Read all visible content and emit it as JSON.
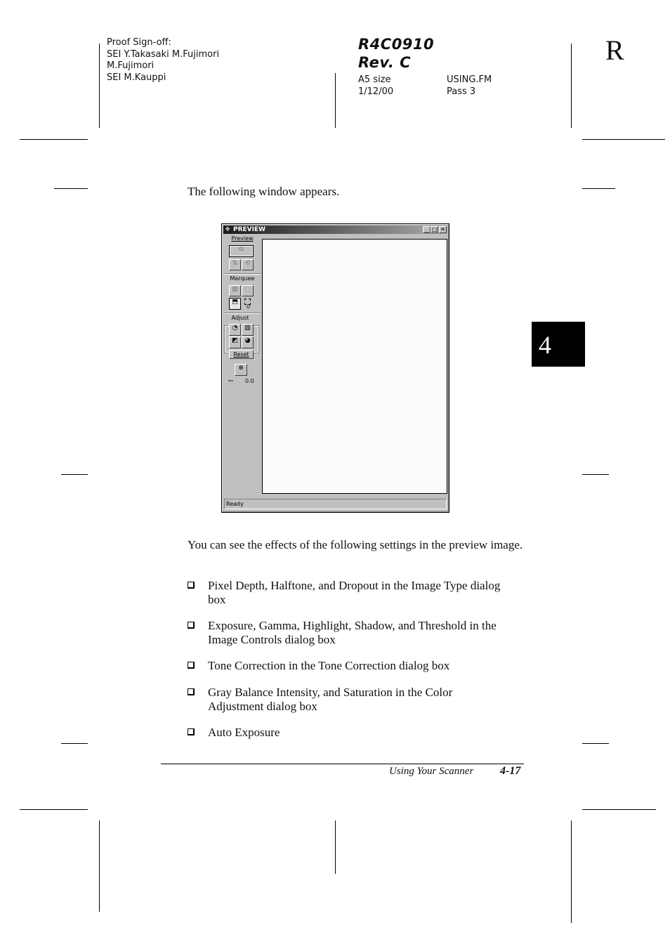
{
  "header": {
    "proof_lines": [
      "Proof Sign-off:",
      "SEI Y.Takasaki M.Fujimori",
      "M.Fujimori",
      "SEI M.Kauppi"
    ],
    "doc_code": "R4C0910",
    "revision": "Rev. C",
    "size": "A5 size",
    "date": "1/12/00",
    "file": "USING.FM",
    "pass": "Pass 3",
    "corner_letter": "R"
  },
  "chapter_tab": "4",
  "intro": "The following window appears.",
  "window": {
    "title": "PREVIEW",
    "sections": {
      "preview": "Preview",
      "marquee": "Marquee",
      "adjust": "Adjust"
    },
    "reset_label": "Reset",
    "marquee_count": "0",
    "zoom_value": "0.0",
    "status": "Ready",
    "title_buttons": [
      "_",
      "□",
      "✕"
    ]
  },
  "paragraph": "You can see the effects of the following settings in the preview image.",
  "bullets": [
    [
      "Pixel Depth, Halftone, and Dropout in the Image Type dialog",
      "box"
    ],
    [
      "Exposure, Gamma, Highlight, Shadow, and Threshold in the",
      "Image Controls dialog box"
    ],
    [
      "Tone Correction in the Tone Correction dialog box"
    ],
    [
      "Gray Balance Intensity, and Saturation in the Color",
      "Adjustment dialog box"
    ],
    [
      "Auto Exposure"
    ]
  ],
  "footer": {
    "section": "Using Your Scanner",
    "page": "4-17"
  }
}
